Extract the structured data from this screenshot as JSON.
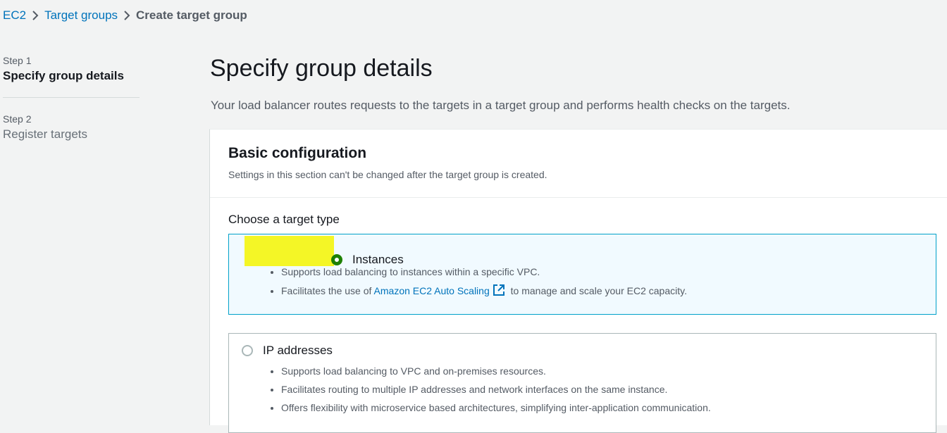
{
  "breadcrumb": {
    "items": [
      "EC2",
      "Target groups"
    ],
    "current": "Create target group"
  },
  "steps": [
    {
      "num": "Step 1",
      "title": "Specify group details"
    },
    {
      "num": "Step 2",
      "title": "Register targets"
    }
  ],
  "main": {
    "title": "Specify group details",
    "description": "Your load balancer routes requests to the targets in a target group and performs health checks on the targets."
  },
  "panel": {
    "title": "Basic configuration",
    "subtitle": "Settings in this section can't be changed after the target group is created.",
    "target_type_label": "Choose a target type",
    "options": [
      {
        "label": "Instances",
        "selected": true,
        "bullets": [
          "Supports load balancing to instances within a specific VPC.",
          {
            "prefix": "Facilitates the use of ",
            "link": "Amazon EC2 Auto Scaling",
            "suffix": " to manage and scale your EC2 capacity."
          }
        ]
      },
      {
        "label": "IP addresses",
        "selected": false,
        "bullets": [
          "Supports load balancing to VPC and on-premises resources.",
          "Facilitates routing to multiple IP addresses and network interfaces on the same instance.",
          "Offers flexibility with microservice based architectures, simplifying inter-application communication."
        ]
      }
    ]
  },
  "colors": {
    "link": "#0073bb",
    "selected_border": "#00a1c9",
    "selected_bg": "#f1faff",
    "radio_checked": "#1d8102",
    "highlight": "#f5f500"
  },
  "icons": {
    "breadcrumb_separator": "chevron-right-icon",
    "external_link": "external-link-icon"
  }
}
